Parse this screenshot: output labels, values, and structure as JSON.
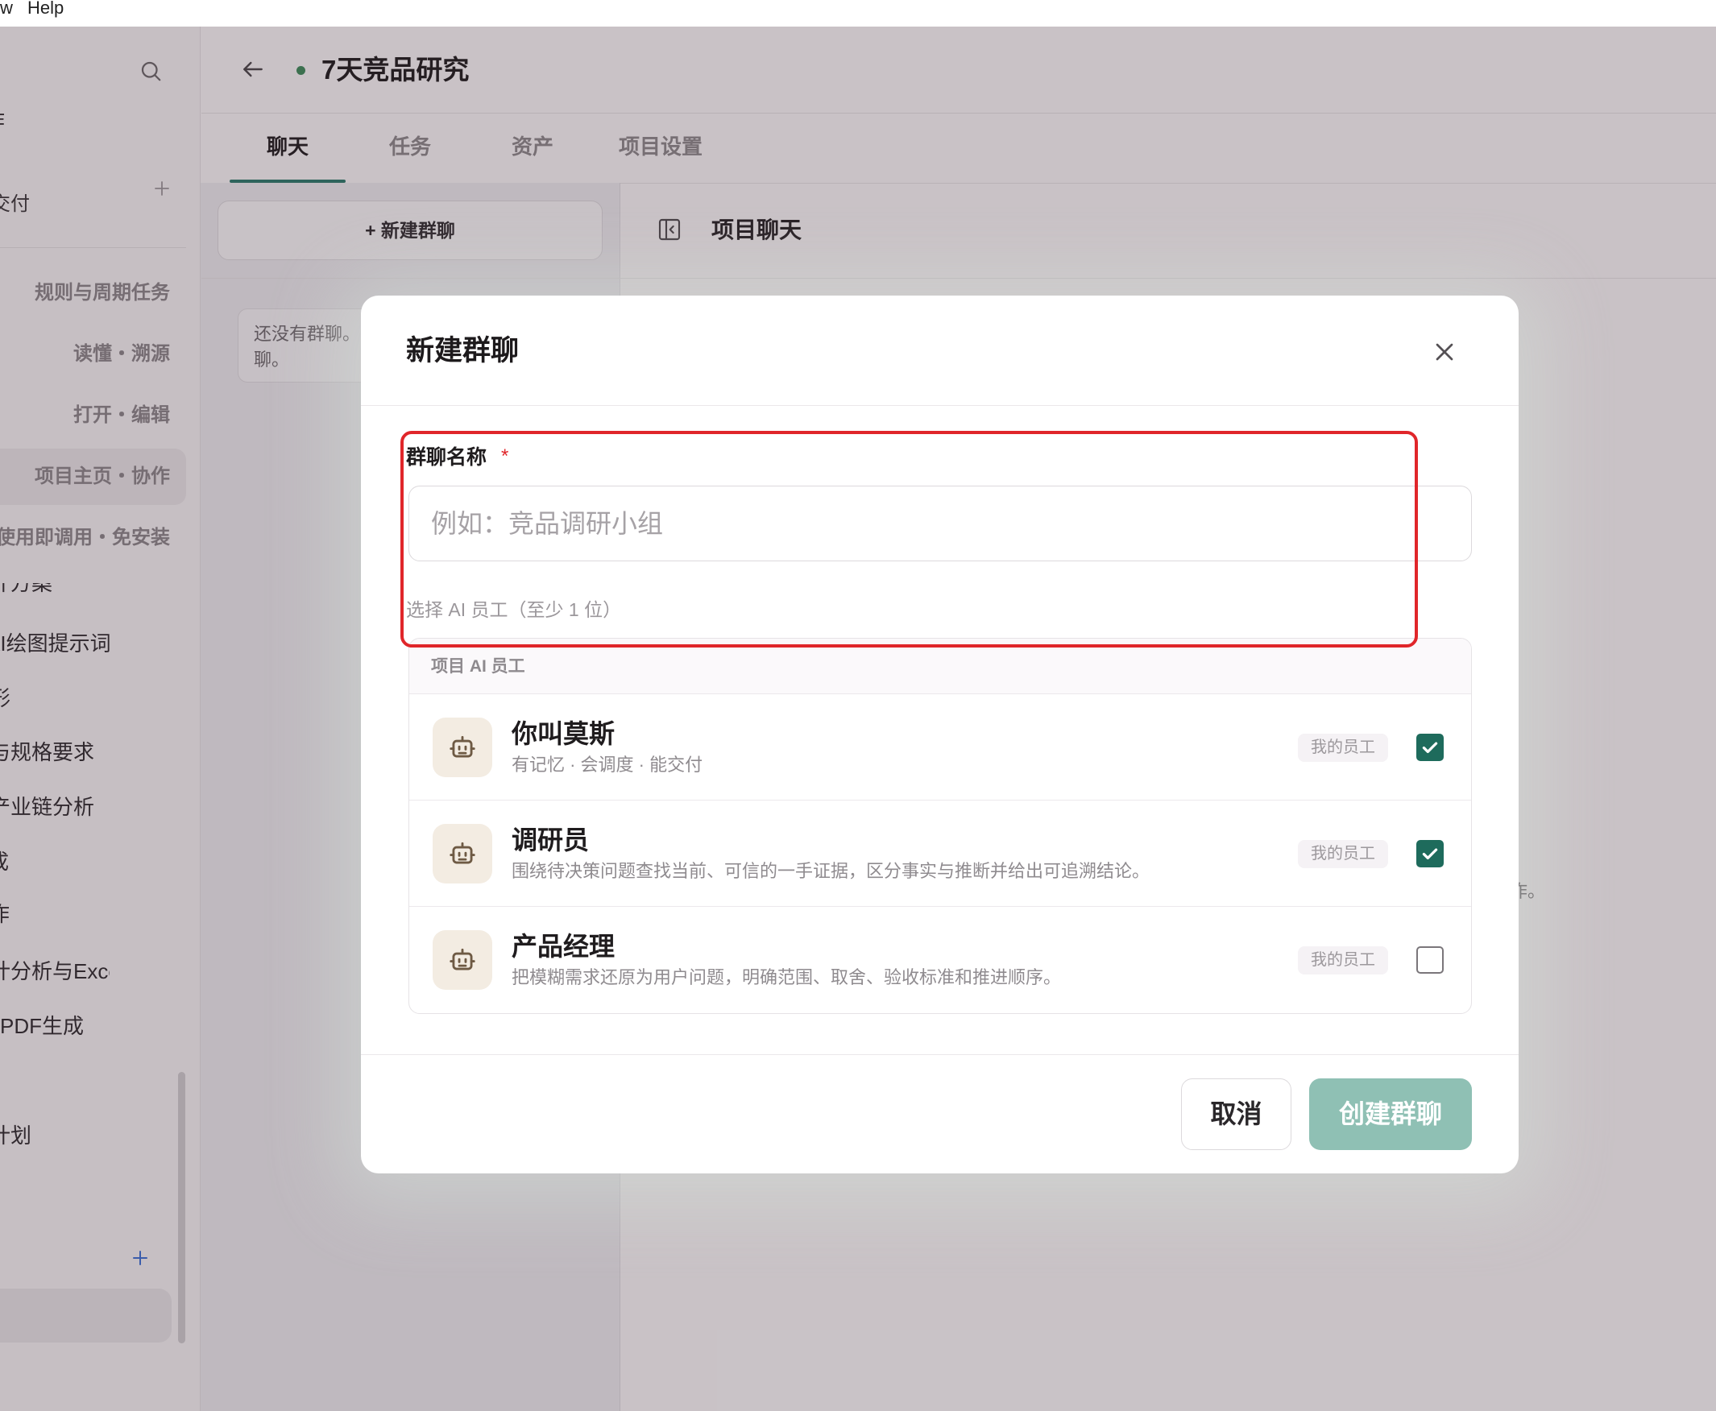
{
  "menubar": {
    "items": [
      "w",
      "Help"
    ]
  },
  "sidebar": {
    "header_fragment": "作",
    "section_label": "交付",
    "upper_items": [
      {
        "label": "规则与周期任务",
        "active": false
      },
      {
        "label": "读懂・溯源",
        "active": false
      },
      {
        "label": "打开・编辑",
        "active": false
      },
      {
        "label": "项目主页・协作",
        "active": true
      },
      {
        "label": "使用即调用・免安装",
        "active": false
      }
    ],
    "lower_items": [
      "计方案",
      "AI绘图提示词",
      "形",
      "与规格要求",
      "产业链分析",
      "成",
      "作",
      "统计分析与Excel",
      "PDF生成",
      "计划"
    ]
  },
  "header": {
    "title": "7天竞品研究"
  },
  "tabs": [
    {
      "label": "聊天",
      "active": true
    },
    {
      "label": "任务",
      "active": false
    },
    {
      "label": "资产",
      "active": false
    },
    {
      "label": "项目设置",
      "active": false
    }
  ],
  "chat_list": {
    "new_button": "+ 新建群聊",
    "empty_line1": "还没有群聊。",
    "empty_line2": "聊。"
  },
  "chat_panel": {
    "title": "项目聊天",
    "fragment": "作。"
  },
  "modal": {
    "title": "新建群聊",
    "name_field": {
      "label": "群聊名称",
      "required_mark": "*",
      "placeholder": "例如：竞品调研小组",
      "value": ""
    },
    "employee_hint": "选择 AI 员工（至少 1 位）",
    "list_header": "项目 AI 员工",
    "employees": [
      {
        "name": "你叫莫斯",
        "desc": "有记忆 · 会调度 · 能交付",
        "badge": "我的员工",
        "checked": true
      },
      {
        "name": "调研员",
        "desc": "围绕待决策问题查找当前、可信的一手证据，区分事实与推断并给出可追溯结论。",
        "badge": "我的员工",
        "checked": true
      },
      {
        "name": "产品经理",
        "desc": "把模糊需求还原为用户问题，明确范围、取舍、验收标准和推进顺序。",
        "badge": "我的员工",
        "checked": false
      }
    ],
    "cancel_label": "取消",
    "create_label": "创建群聊",
    "create_disabled": true
  },
  "colors": {
    "accent": "#2b7a6b",
    "status_dot": "#3d8a5a",
    "annotation": "#e0262a",
    "create_disabled": "#8fc0b4",
    "checkbox_checked": "#1e6b5c",
    "sidebar_add": "#3b6fd6"
  },
  "icons": {
    "search": "search-icon",
    "add": "plus-icon",
    "back": "back-arrow-icon",
    "panel_toggle": "panel-collapse-icon",
    "close": "close-icon",
    "employee": "robot-icon",
    "check": "check-icon"
  }
}
